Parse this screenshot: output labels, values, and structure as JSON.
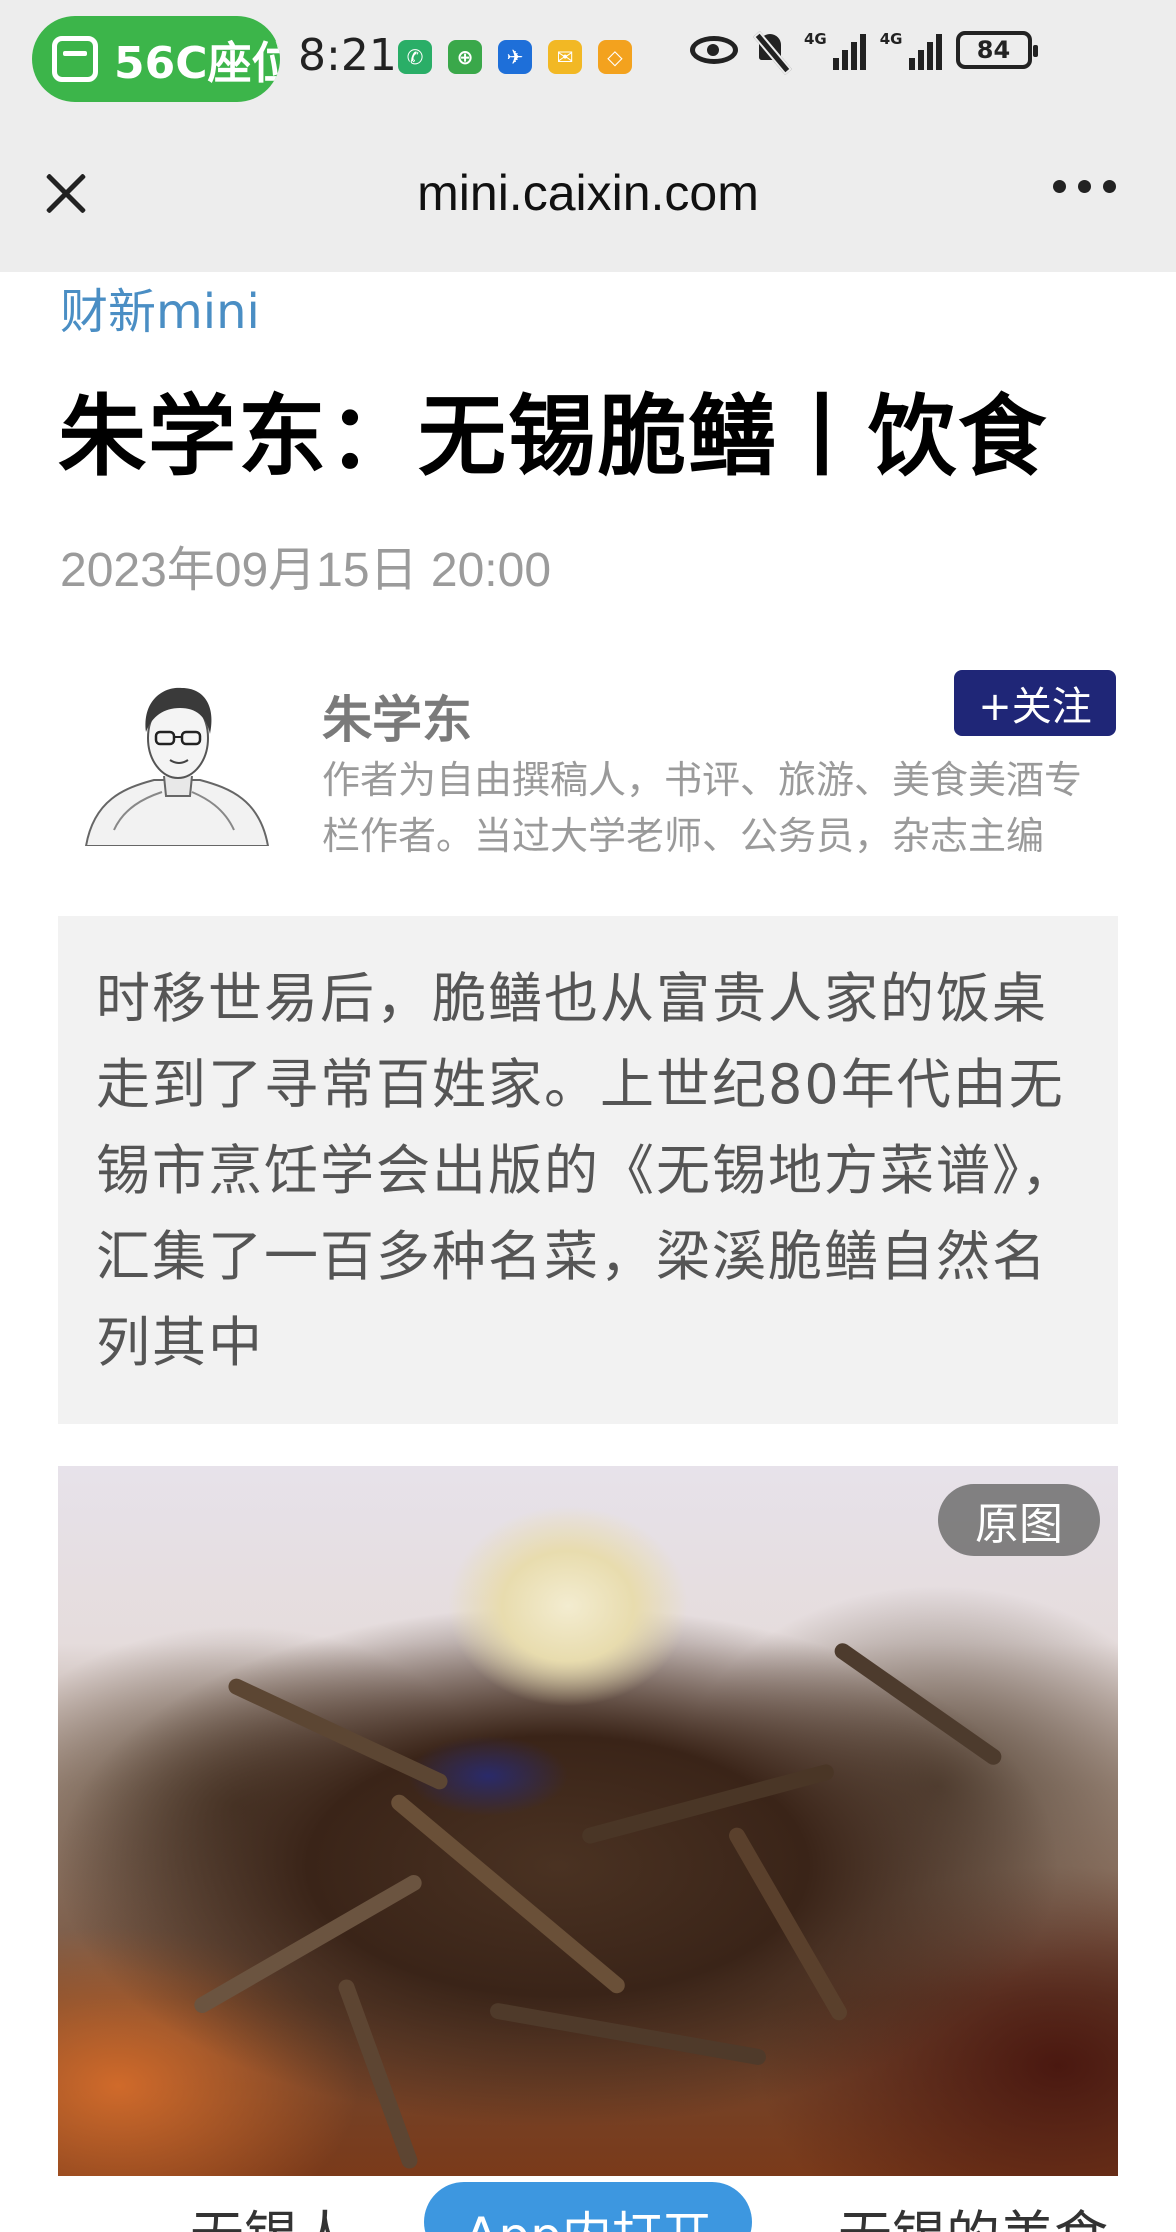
{
  "status_bar": {
    "pill_text": "56C座位",
    "time": "8:21",
    "app_icons": [
      {
        "name": "wechat-icon",
        "color": "#2aae67"
      },
      {
        "name": "app-green-icon",
        "color": "#3aa84a"
      },
      {
        "name": "flight-icon",
        "color": "#1e6fd9"
      },
      {
        "name": "mail-icon",
        "color": "#f2b824"
      },
      {
        "name": "app-orange-icon",
        "color": "#f3a21e"
      }
    ],
    "network_1": "4G",
    "network_2": "4G",
    "battery": "84"
  },
  "nav": {
    "title": "mini.caixin.com"
  },
  "article": {
    "brand": "财新mini",
    "title": "朱学东：无锡脆鳝丨饮食",
    "date": "2023年09月15日 20:00",
    "author": {
      "name": "朱学东",
      "follow_label": "+关注",
      "bio": "作者为自由撰稿人，书评、旅游、美食美酒专栏作者。当过大学老师、公务员，杂志主编"
    },
    "summary": "时移世易后，脆鳝也从富贵人家的饭桌走到了寻常百姓家。上世纪80年代由无锡市烹饪学会出版的《无锡地方菜谱》，汇集了一百多种名菜，梁溪脆鳝自然名列其中",
    "image": {
      "original_label": "原图"
    },
    "next_text": "无锡人　　　　　　　　　无锡的美食"
  },
  "open_app_label": "App内打开",
  "colors": {
    "accent_blue": "#4a8ec4",
    "follow_button": "#1f2677",
    "open_app_button": "#3d97e0",
    "status_pill": "#3cb54a"
  }
}
